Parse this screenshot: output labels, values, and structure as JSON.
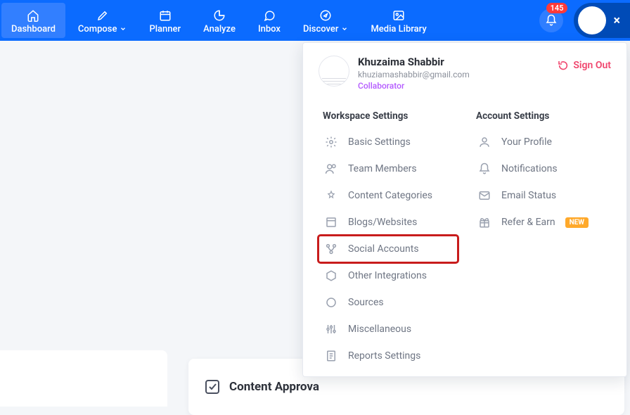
{
  "nav": {
    "items": [
      {
        "label": "Dashboard",
        "active": true
      },
      {
        "label": "Compose",
        "caret": true
      },
      {
        "label": "Planner"
      },
      {
        "label": "Analyze"
      },
      {
        "label": "Inbox"
      },
      {
        "label": "Discover",
        "caret": true
      },
      {
        "label": "Media Library"
      }
    ],
    "notification_count": "145"
  },
  "user": {
    "name": "Khuzaima Shabbir",
    "email": "khuziamashabbir@gmail.com",
    "role": "Collaborator"
  },
  "signout_label": "Sign Out",
  "workspace": {
    "title": "Workspace Settings",
    "items": [
      "Basic Settings",
      "Team Members",
      "Content Categories",
      "Blogs/Websites",
      "Social Accounts",
      "Other Integrations",
      "Sources",
      "Miscellaneous",
      "Reports Settings"
    ]
  },
  "account": {
    "title": "Account Settings",
    "items": [
      "Your Profile",
      "Notifications",
      "Email Status",
      "Refer & Earn"
    ],
    "new_badge": "NEW"
  },
  "bottom": {
    "title": "Content Approva"
  }
}
